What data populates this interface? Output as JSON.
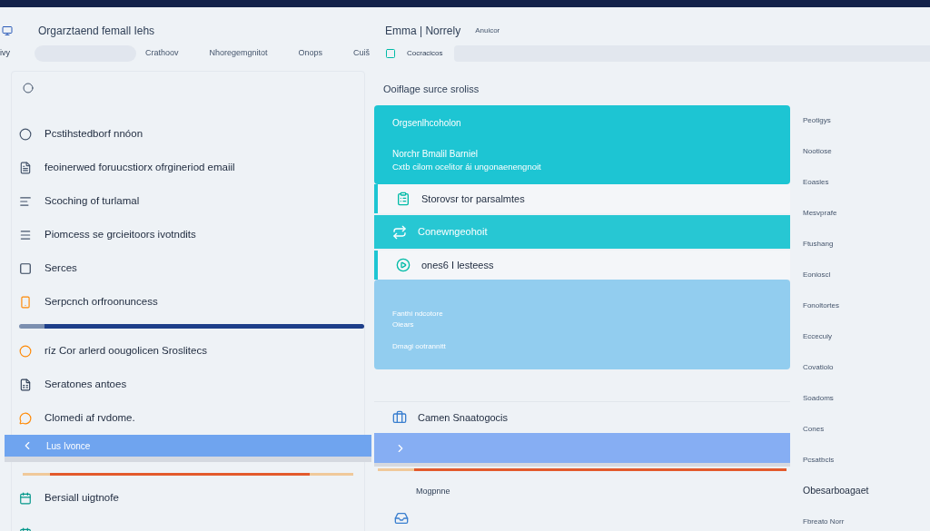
{
  "header": {
    "title": "Orgarztaend femall Iehs",
    "user_name": "Emma | Norrely",
    "user_role": "Anuicor",
    "nav_label": "ivy",
    "nav_links": [
      "Crathoov",
      "Nhoregemgnitot",
      "Onops",
      "Cuiš"
    ],
    "tab_label": "Cocracicos"
  },
  "sidebar": {
    "items": [
      {
        "label": "Pcstihstedborf nnóon",
        "selected": false
      },
      {
        "label": "feoinerwed foruucstiorx ofrgineriod emaiil",
        "selected": false
      },
      {
        "label": "Scoching of turlamal",
        "selected": false
      },
      {
        "label": "Piomcess se grcieitoors ivotndits",
        "selected": false
      },
      {
        "label": "Serces",
        "selected": false
      },
      {
        "label": "Serpcnch orfroonuncess",
        "selected": false
      },
      {
        "label": "ríz Cor arlerd oougolicen Sroslitecs",
        "selected": false
      },
      {
        "label": "Seratones antoes",
        "selected": false
      },
      {
        "label": "Clomedi af rvdome.",
        "selected": false
      },
      {
        "label": "Lus Ivonce",
        "selected": true
      },
      {
        "label": "Bersiall uigtnofe",
        "selected": false
      }
    ]
  },
  "main": {
    "heading": "Ooiflage surce sroliss",
    "feature_card": {
      "title": "Orgsenlhcoholon",
      "subtitle": "Norchr Bmalil Barniel",
      "text": "Cxtb cilom ocelitor ái ungonaenengnoit"
    },
    "rows": [
      {
        "label": "Storovsr tor parsalmtes",
        "selected": false
      },
      {
        "label": "Conewngeohoit",
        "selected": true
      },
      {
        "label": "ones6 I lesteess",
        "selected": false
      }
    ],
    "info_card": {
      "lines": [
        "Fanthi ndcotore",
        "Oiears",
        "Dmagi ootrannitt"
      ]
    },
    "section_title": "Camen Snaatogocis",
    "footer_label": "Mogpnne"
  },
  "side_links": [
    "Peotigys",
    "Nootiose",
    "Eoasles",
    "Mesvprafe",
    "Ftushang",
    "Eonioscl",
    "Fonoltortes",
    "Eccecuiy",
    "Covatiolo",
    "Soadoms",
    "Cones",
    "Pcsatbcls",
    "Obesarboagaet",
    "Fbreato Norr"
  ]
}
